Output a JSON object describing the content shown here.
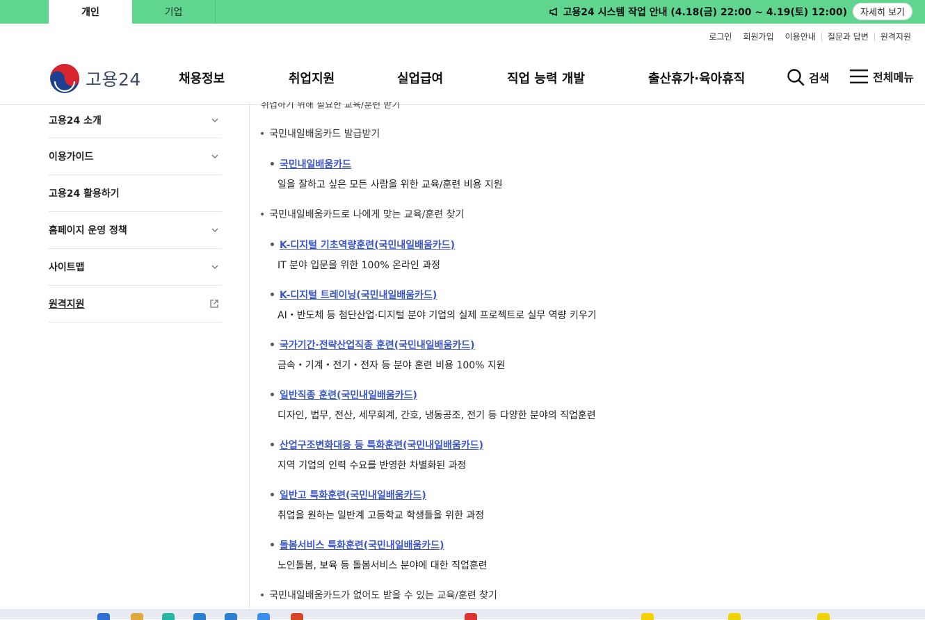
{
  "top_tabs": [
    {
      "label": "개인",
      "active": true
    },
    {
      "label": "기업",
      "active": false
    }
  ],
  "notice": {
    "icon": "megaphone-icon",
    "text": "고용24 시스템 작업 안내 (4.18(금) 22:00 ~ 4.19(토) 12:00)",
    "button": "자세히 보기"
  },
  "util_links": [
    "로그인",
    "회원가입",
    "이용안내",
    "질문과 답변",
    "원격지원"
  ],
  "logo": {
    "text": "고용24"
  },
  "gnb": [
    "채용정보",
    "취업지원",
    "실업급여",
    "직업 능력 개발",
    "출산휴가·육아휴직"
  ],
  "search_label": "검색",
  "all_menu_label": "전체메뉴",
  "sidebar": [
    {
      "label": "고용24 소개",
      "icon": "chevron-down-icon"
    },
    {
      "label": "이용가이드",
      "icon": "chevron-down-icon"
    },
    {
      "label": "고용24 활용하기",
      "icon": ""
    },
    {
      "label": "홈페이지 운영 정책",
      "icon": "chevron-down-icon"
    },
    {
      "label": "사이트맵",
      "icon": "chevron-down-icon"
    },
    {
      "label": "원격지원",
      "icon": "external-link-icon"
    }
  ],
  "content": {
    "cut_text": "취업하기 위해 필요한 교육/훈련 받기",
    "section1": "국민내일배움카드 발급받기",
    "section2": "국민내일배움카드로 나에게 맞는 교육/훈련 찾기",
    "section3": "국민내일배움카드가 없어도 받을 수 있는 교육/훈련 찾기",
    "items": [
      {
        "title": "국민내일배움카드",
        "desc": "일을 잘하고 싶은 모든 사람을 위한 교육/훈련 비용 지원"
      },
      {
        "title": "K-디지털 기초역량훈련(국민내일배움카드)",
        "desc": "IT 분야 입문을 위한 100% 온라인 과정"
      },
      {
        "title": "K-디지털 트레이닝(국민내일배움카드)",
        "desc": "AI・반도체 등 첨단산업·디지털 분야 기업의 실제 프로젝트로 실무 역량 키우기"
      },
      {
        "title": "국가기간·전략산업직종 훈련(국민내일배움카드)",
        "desc": "금속・기계・전기・전자 등 분야 훈련 비용 100% 지원"
      },
      {
        "title": "일반직종 훈련(국민내일배움카드)",
        "desc": "디자인, 법무, 전산, 세무회계, 간호, 냉동공조, 전기 등 다양한 분야의 직업훈련"
      },
      {
        "title": "산업구조변화대응 등 특화훈련(국민내일배움카드)",
        "desc": "지역 기업의 인력 수요를 반영한 차별화된 과정"
      },
      {
        "title": "일반고 특화훈련(국민내일배움카드)",
        "desc": "취업을 원하는 일반계 고등학교 학생들을 위한 과정"
      },
      {
        "title": "돌봄서비스 특화훈련(국민내일배움카드)",
        "desc": "노인돌봄, 보육 등 돌봄서비스 분야에 대한 직업훈련"
      }
    ]
  },
  "colors": {
    "topbar": "#5fd58f",
    "link": "#3a56c5"
  }
}
